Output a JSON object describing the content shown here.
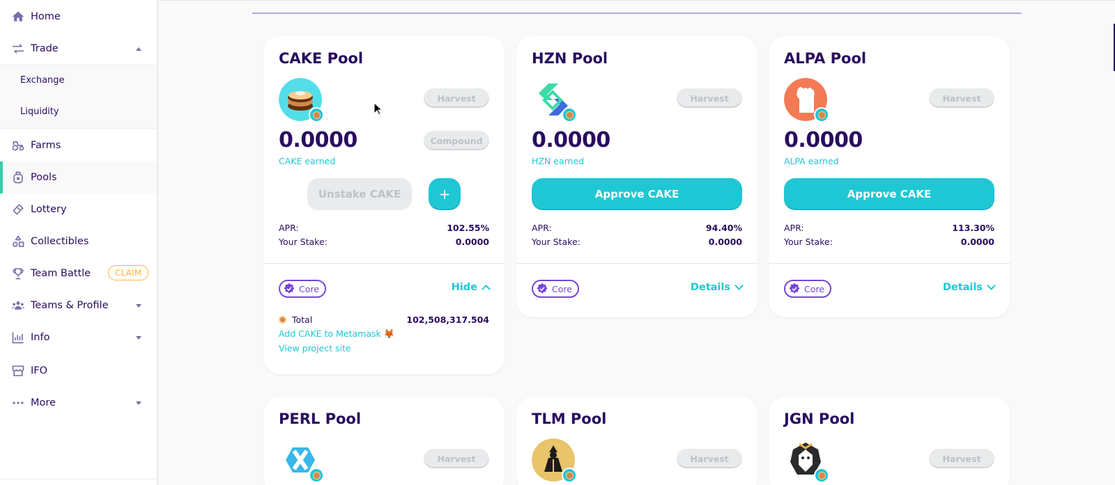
{
  "sidebar": {
    "items": [
      {
        "label": "Home",
        "icon": "home-icon"
      },
      {
        "label": "Trade",
        "icon": "swap-icon"
      },
      {
        "label": "Farms",
        "icon": "tractor-icon"
      },
      {
        "label": "Pools",
        "icon": "pot-icon"
      },
      {
        "label": "Lottery",
        "icon": "ticket-icon"
      },
      {
        "label": "Collectibles",
        "icon": "shapes-icon"
      },
      {
        "label": "Team Battle",
        "icon": "trophy-icon",
        "badge": "CLAIM"
      },
      {
        "label": "Teams & Profile",
        "icon": "team-icon"
      },
      {
        "label": "Info",
        "icon": "chart-icon"
      },
      {
        "label": "IFO",
        "icon": "store-icon"
      },
      {
        "label": "More",
        "icon": "dots-icon"
      }
    ],
    "trade_sub": [
      {
        "label": "Exchange"
      },
      {
        "label": "Liquidity"
      }
    ],
    "active": "Pools"
  },
  "pools": [
    {
      "title": "CAKE Pool",
      "token": "CAKE",
      "harvest_label": "Harvest",
      "compound_label": "Compound",
      "earned_value": "0.0000",
      "earned_label": "CAKE earned",
      "unstake_label": "Unstake CAKE",
      "plus_label": "+",
      "apr_label": "APR:",
      "apr_value": "102.55%",
      "stake_label": "Your Stake:",
      "stake_value": "0.0000",
      "tag": "Core",
      "toggle_label": "Hide",
      "total_label": "Total",
      "total_value": "102,508,317.504",
      "add_metamask_label": "Add CAKE to Metamask 🦊",
      "project_site_label": "View project site"
    },
    {
      "title": "HZN Pool",
      "token": "HZN",
      "harvest_label": "Harvest",
      "earned_value": "0.0000",
      "earned_label": "HZN earned",
      "approve_label": "Approve CAKE",
      "apr_label": "APR:",
      "apr_value": "94.40%",
      "stake_label": "Your Stake:",
      "stake_value": "0.0000",
      "tag": "Core",
      "toggle_label": "Details"
    },
    {
      "title": "ALPA Pool",
      "token": "ALPA",
      "harvest_label": "Harvest",
      "earned_value": "0.0000",
      "earned_label": "ALPA earned",
      "approve_label": "Approve CAKE",
      "apr_label": "APR:",
      "apr_value": "113.30%",
      "stake_label": "Your Stake:",
      "stake_value": "0.0000",
      "tag": "Core",
      "toggle_label": "Details"
    },
    {
      "title": "PERL Pool",
      "token": "PERL",
      "harvest_label": "Harvest"
    },
    {
      "title": "TLM Pool",
      "token": "TLM",
      "harvest_label": "Harvest"
    },
    {
      "title": "JGN Pool",
      "token": "JGN",
      "harvest_label": "Harvest"
    }
  ],
  "colors": {
    "primary": "#1fc7d4",
    "text": "#280d5f",
    "secondary": "#7645d9",
    "warning": "#ffb237",
    "success": "#31d0aa",
    "disabled": "#e9eaeb"
  }
}
